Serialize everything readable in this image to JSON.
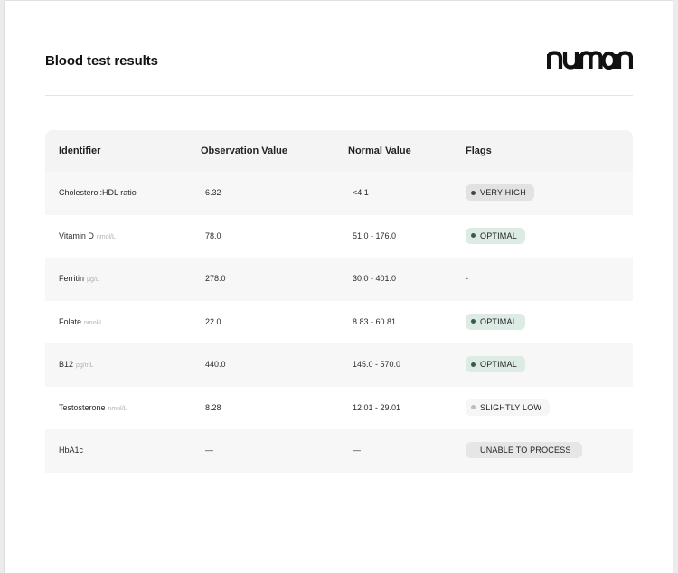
{
  "title": "Blood test results",
  "logo_text": "numan",
  "table": {
    "headers": [
      "Identifier",
      "Observation Value",
      "Normal Value",
      "Flags"
    ],
    "rows": [
      {
        "identifier": "Cholesterol:HDL ratio",
        "unit": "",
        "value": "6.32",
        "normal": "<4.1",
        "flag": "VERY HIGH",
        "flag_type": "high"
      },
      {
        "identifier": "Vitamin D",
        "unit": "nmol/L",
        "value": "78.0",
        "normal": "51.0 - 176.0",
        "flag": "OPTIMAL",
        "flag_type": "optimal"
      },
      {
        "identifier": "Ferritin",
        "unit": "µg/L",
        "value": "278.0",
        "normal": "30.0 - 401.0",
        "flag": "-",
        "flag_type": "none"
      },
      {
        "identifier": "Folate",
        "unit": "nmol/L",
        "value": "22.0",
        "normal": "8.83 - 60.81",
        "flag": "OPTIMAL",
        "flag_type": "optimal"
      },
      {
        "identifier": "B12",
        "unit": "pg/mL",
        "value": "440.0",
        "normal": "145.0 - 570.0",
        "flag": "OPTIMAL",
        "flag_type": "optimal"
      },
      {
        "identifier": "Testosterone",
        "unit": "nmol/L",
        "value": "8.28",
        "normal": "12.01 - 29.01",
        "flag": "SLIGHTLY LOW",
        "flag_type": "low"
      },
      {
        "identifier": "HbA1c",
        "unit": "",
        "value": "—",
        "normal": "—",
        "flag": "UNABLE TO PROCESS",
        "flag_type": "unable"
      }
    ]
  },
  "colors": {
    "optimal_badge": "#dcebe4",
    "high_badge": "#e2e2e2",
    "low_badge": "#f6f6f6",
    "unable_badge": "#e6e6e6"
  }
}
